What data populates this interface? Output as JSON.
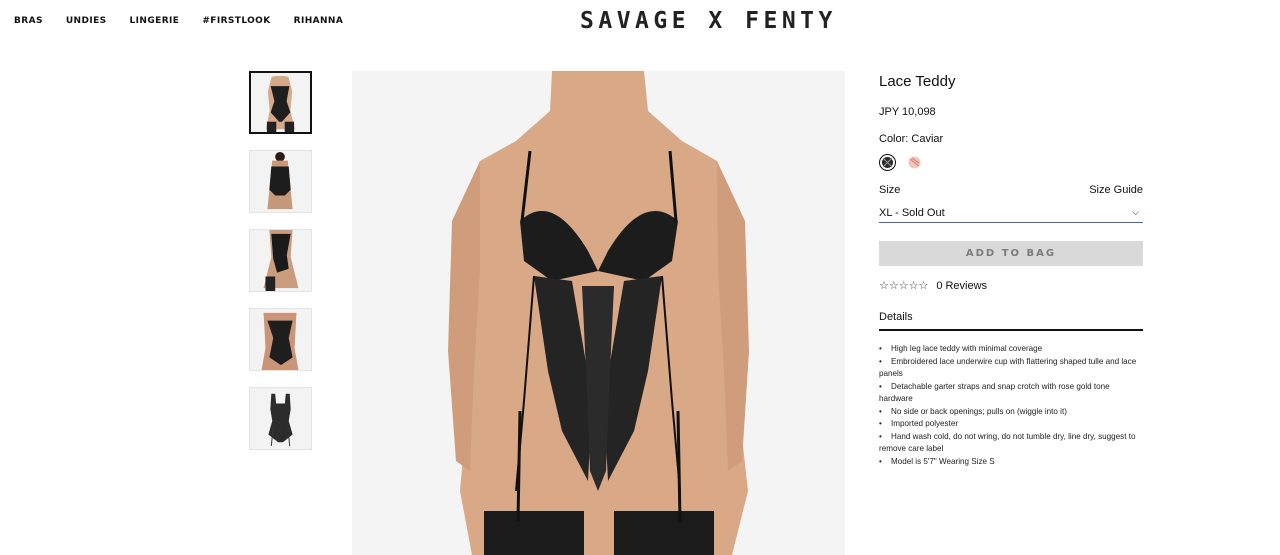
{
  "nav": {
    "items": [
      "BRAS",
      "UNDIES",
      "LINGERIE",
      "#FIRSTLOOK",
      "RIHANNA"
    ]
  },
  "brand": {
    "logo": "SAVAGE X FENTY"
  },
  "gallery": {
    "thumbnail_count": 5,
    "active_index": 0
  },
  "product": {
    "title": "Lace Teddy",
    "price": "JPY 10,098",
    "color_label": "Color: Caviar",
    "swatches": [
      {
        "name": "caviar-swatch",
        "color": "#2b2b2b",
        "selected": true
      },
      {
        "name": "rose-swatch",
        "color": "#e8b2a8",
        "selected": false
      }
    ],
    "size_label": "Size",
    "size_guide": "Size Guide",
    "size_selected": "XL - Sold Out",
    "add_to_bag": "ADD TO BAG",
    "rating_stars": "☆☆☆☆☆",
    "reviews": "0 Reviews",
    "details_label": "Details",
    "details": [
      "High leg lace teddy with minimal coverage",
      "Embroidered lace underwire cup with flattering shaped tulle and lace panels",
      "Detachable garter straps and snap crotch with rose gold tone hardware",
      "No side or back openings; pulls on (wiggle into it)",
      "Imported polyester",
      "Hand wash cold, do not wring, do not tumble dry, line dry, suggest to remove care label",
      "Model is 5'7\" Wearing Size S"
    ]
  },
  "colors": {
    "accent_underline": "#4a5fc1",
    "bag_button_bg": "#d9d9d9",
    "bag_button_text": "#7b7b7b"
  }
}
